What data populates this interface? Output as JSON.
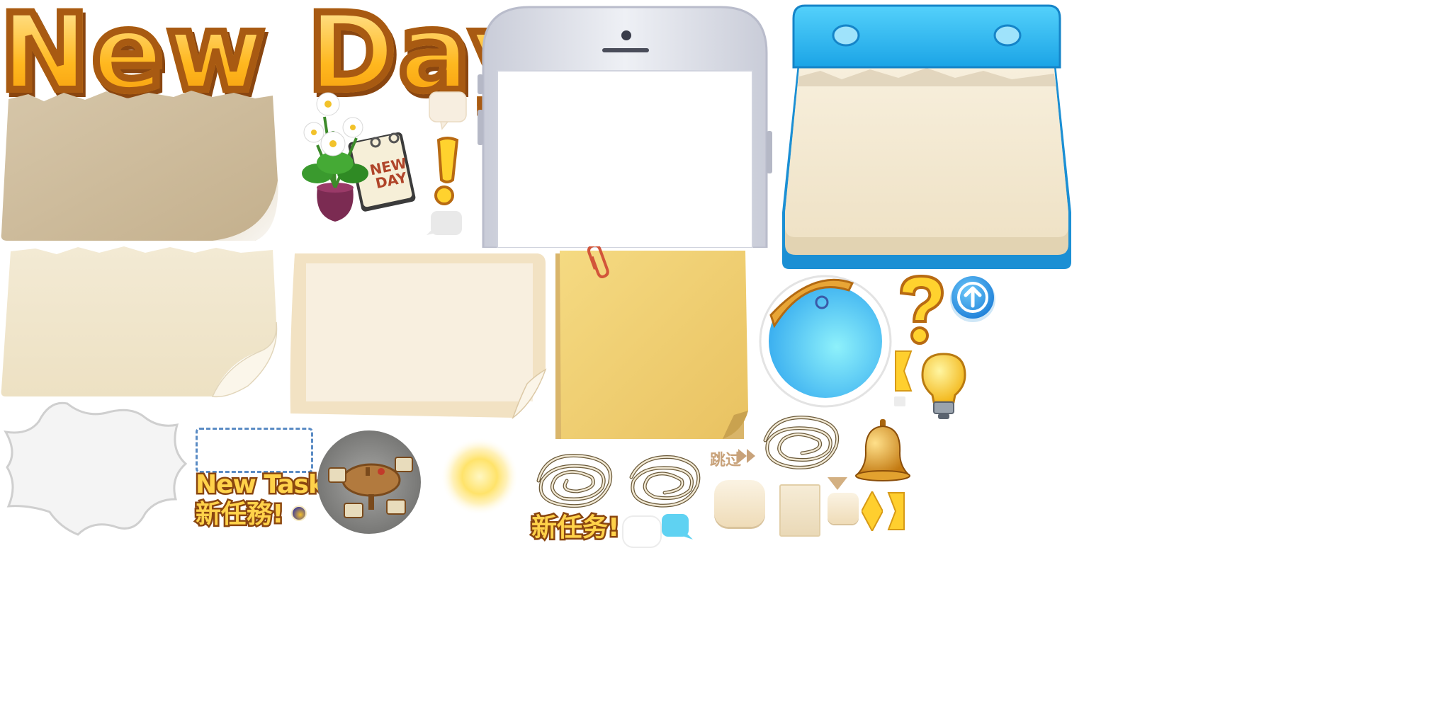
{
  "title": {
    "banner": "New Day !"
  },
  "calendar_icon": {
    "label_line1": "NEW",
    "label_line2": "DAY"
  },
  "task_badges": {
    "new_task_en": "New Task!",
    "new_task_tc": "新任務!",
    "new_task_sc": "新任务!"
  },
  "skip_button": {
    "label": "跳过"
  },
  "colors": {
    "title_fill": "#ffc23a",
    "title_outline": "#a85a12",
    "calendar_blue": "#29b6f0",
    "paper_cream": "#f6ecd6",
    "sticky_yellow": "#f1d173",
    "bubble_blue": "#5fd2f2"
  },
  "icons": [
    "exclamation-icon",
    "question-icon",
    "up-arrow-icon",
    "lightbulb-icon",
    "bell-icon",
    "sun-glow-icon",
    "fast-forward-icon",
    "paperclip-icon",
    "flower-pot-icon"
  ]
}
